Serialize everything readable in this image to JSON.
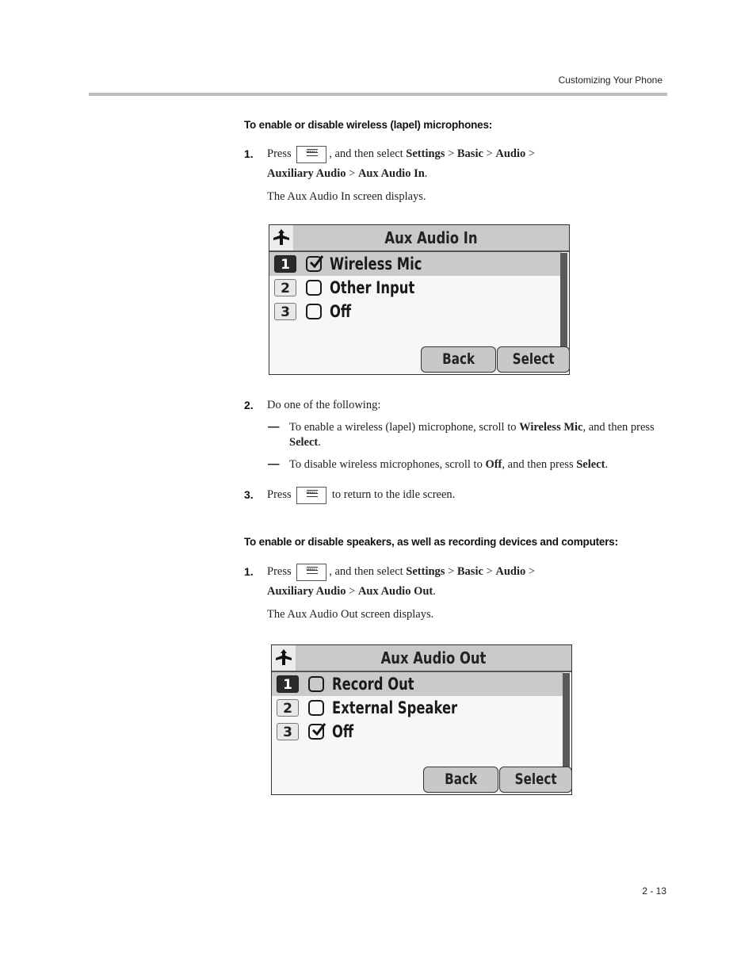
{
  "header": {
    "section_title": "Customizing Your Phone"
  },
  "procedure1": {
    "heading": "To enable or disable wireless (lapel) microphones:",
    "step1": {
      "num": "1.",
      "press": "Press",
      "key_label": "MENU",
      "after_key": ", and then select ",
      "path": [
        "Settings",
        "Basic",
        "Audio",
        "Auxiliary Audio",
        "Aux Audio In"
      ],
      "sep": " > ",
      "end": ".",
      "result": "The Aux Audio In screen displays."
    },
    "screen": {
      "title": "Aux Audio In",
      "items": [
        {
          "num": "1",
          "label": "Wireless Mic",
          "checked": true,
          "selected": true
        },
        {
          "num": "2",
          "label": "Other Input",
          "checked": false,
          "selected": false
        },
        {
          "num": "3",
          "label": "Off",
          "checked": false,
          "selected": false
        }
      ],
      "softkeys": [
        "Back",
        "Select"
      ]
    },
    "step2": {
      "num": "2.",
      "text": "Do one of the following:",
      "bullets": [
        {
          "dash": "—",
          "pre": "To enable a wireless (lapel) microphone, scroll to ",
          "b1": "Wireless Mic",
          "mid": ", and then press ",
          "b2": "Select",
          "post": "."
        },
        {
          "dash": "—",
          "pre": "To disable wireless microphones, scroll to ",
          "b1": "Off",
          "mid": ", and then press ",
          "b2": "Select",
          "post": "."
        }
      ]
    },
    "step3": {
      "num": "3.",
      "press": "Press",
      "key_label": "MENU",
      "after_key": " to return to the idle screen."
    }
  },
  "procedure2": {
    "heading": "To enable or disable speakers, as well as recording devices and computers:",
    "step1": {
      "num": "1.",
      "press": "Press",
      "key_label": "MENU",
      "after_key": ", and then select ",
      "path": [
        "Settings",
        "Basic",
        "Audio",
        "Auxiliary Audio",
        "Aux Audio Out"
      ],
      "sep": " > ",
      "end": ".",
      "result": "The Aux Audio Out screen displays."
    },
    "screen": {
      "title": "Aux Audio Out",
      "items": [
        {
          "num": "1",
          "label": "Record Out",
          "checked": false,
          "selected": true
        },
        {
          "num": "2",
          "label": "External Speaker",
          "checked": false,
          "selected": false
        },
        {
          "num": "3",
          "label": "Off",
          "checked": true,
          "selected": false
        }
      ],
      "softkeys": [
        "Back",
        "Select"
      ]
    }
  },
  "footer": {
    "page_number": "2 - 13"
  }
}
